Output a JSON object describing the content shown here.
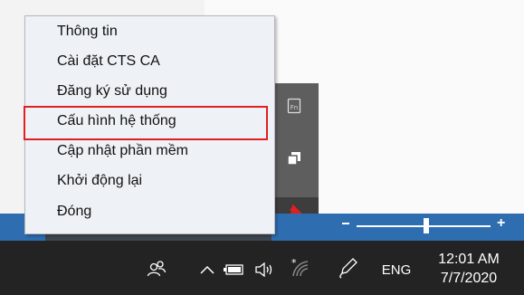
{
  "context_menu": {
    "items": [
      {
        "label": "Thông tin"
      },
      {
        "label": "Cài đặt CTS CA"
      },
      {
        "label": "Đăng ký sử dụng"
      },
      {
        "label": "Cấu hình hệ thống"
      },
      {
        "label": "Cập nhật phần mềm"
      },
      {
        "label": "Khởi động lại"
      },
      {
        "label": "Đóng"
      }
    ]
  },
  "overflow_tray": {
    "icons": [
      "fn-key-icon",
      "copy-windows-icon",
      "pin-icon"
    ]
  },
  "zoom_slider": {
    "minus": "-",
    "plus": "+",
    "level": 0.5
  },
  "taskbar": {
    "tray_icons": [
      "people-icon",
      "chevron-up-icon",
      "battery-icon",
      "speaker-icon",
      "wifi-icon",
      "pen-icon"
    ],
    "language": "ENG",
    "time": "12:01 AM",
    "date": "7/7/2020"
  },
  "colors": {
    "highlight": "#e02020",
    "taskbar": "#232323",
    "blue_bar": "#2e6db0",
    "pin": "#e02020"
  }
}
